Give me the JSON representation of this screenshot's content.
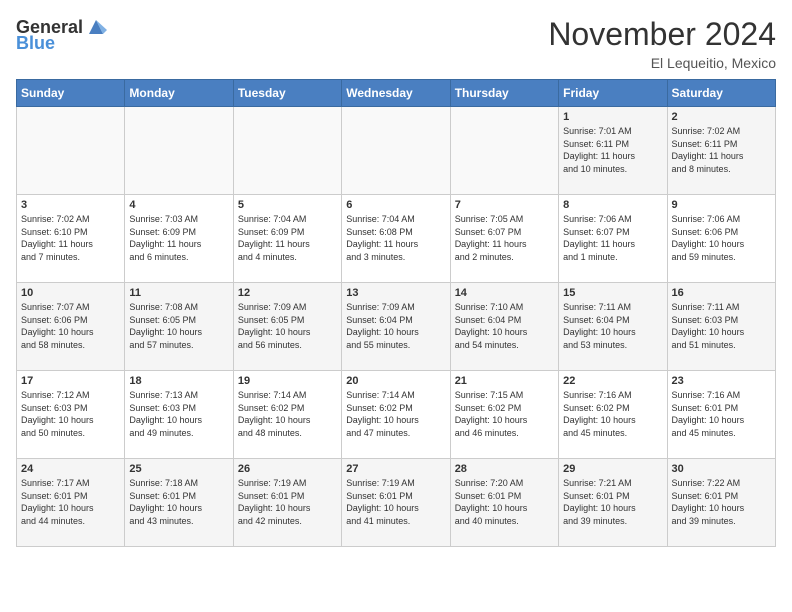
{
  "header": {
    "logo_general": "General",
    "logo_blue": "Blue",
    "month": "November 2024",
    "location": "El Lequeitio, Mexico"
  },
  "weekdays": [
    "Sunday",
    "Monday",
    "Tuesday",
    "Wednesday",
    "Thursday",
    "Friday",
    "Saturday"
  ],
  "rows": [
    [
      {
        "day": "",
        "info": ""
      },
      {
        "day": "",
        "info": ""
      },
      {
        "day": "",
        "info": ""
      },
      {
        "day": "",
        "info": ""
      },
      {
        "day": "",
        "info": ""
      },
      {
        "day": "1",
        "info": "Sunrise: 7:01 AM\nSunset: 6:11 PM\nDaylight: 11 hours\nand 10 minutes."
      },
      {
        "day": "2",
        "info": "Sunrise: 7:02 AM\nSunset: 6:11 PM\nDaylight: 11 hours\nand 8 minutes."
      }
    ],
    [
      {
        "day": "3",
        "info": "Sunrise: 7:02 AM\nSunset: 6:10 PM\nDaylight: 11 hours\nand 7 minutes."
      },
      {
        "day": "4",
        "info": "Sunrise: 7:03 AM\nSunset: 6:09 PM\nDaylight: 11 hours\nand 6 minutes."
      },
      {
        "day": "5",
        "info": "Sunrise: 7:04 AM\nSunset: 6:09 PM\nDaylight: 11 hours\nand 4 minutes."
      },
      {
        "day": "6",
        "info": "Sunrise: 7:04 AM\nSunset: 6:08 PM\nDaylight: 11 hours\nand 3 minutes."
      },
      {
        "day": "7",
        "info": "Sunrise: 7:05 AM\nSunset: 6:07 PM\nDaylight: 11 hours\nand 2 minutes."
      },
      {
        "day": "8",
        "info": "Sunrise: 7:06 AM\nSunset: 6:07 PM\nDaylight: 11 hours\nand 1 minute."
      },
      {
        "day": "9",
        "info": "Sunrise: 7:06 AM\nSunset: 6:06 PM\nDaylight: 10 hours\nand 59 minutes."
      }
    ],
    [
      {
        "day": "10",
        "info": "Sunrise: 7:07 AM\nSunset: 6:06 PM\nDaylight: 10 hours\nand 58 minutes."
      },
      {
        "day": "11",
        "info": "Sunrise: 7:08 AM\nSunset: 6:05 PM\nDaylight: 10 hours\nand 57 minutes."
      },
      {
        "day": "12",
        "info": "Sunrise: 7:09 AM\nSunset: 6:05 PM\nDaylight: 10 hours\nand 56 minutes."
      },
      {
        "day": "13",
        "info": "Sunrise: 7:09 AM\nSunset: 6:04 PM\nDaylight: 10 hours\nand 55 minutes."
      },
      {
        "day": "14",
        "info": "Sunrise: 7:10 AM\nSunset: 6:04 PM\nDaylight: 10 hours\nand 54 minutes."
      },
      {
        "day": "15",
        "info": "Sunrise: 7:11 AM\nSunset: 6:04 PM\nDaylight: 10 hours\nand 53 minutes."
      },
      {
        "day": "16",
        "info": "Sunrise: 7:11 AM\nSunset: 6:03 PM\nDaylight: 10 hours\nand 51 minutes."
      }
    ],
    [
      {
        "day": "17",
        "info": "Sunrise: 7:12 AM\nSunset: 6:03 PM\nDaylight: 10 hours\nand 50 minutes."
      },
      {
        "day": "18",
        "info": "Sunrise: 7:13 AM\nSunset: 6:03 PM\nDaylight: 10 hours\nand 49 minutes."
      },
      {
        "day": "19",
        "info": "Sunrise: 7:14 AM\nSunset: 6:02 PM\nDaylight: 10 hours\nand 48 minutes."
      },
      {
        "day": "20",
        "info": "Sunrise: 7:14 AM\nSunset: 6:02 PM\nDaylight: 10 hours\nand 47 minutes."
      },
      {
        "day": "21",
        "info": "Sunrise: 7:15 AM\nSunset: 6:02 PM\nDaylight: 10 hours\nand 46 minutes."
      },
      {
        "day": "22",
        "info": "Sunrise: 7:16 AM\nSunset: 6:02 PM\nDaylight: 10 hours\nand 45 minutes."
      },
      {
        "day": "23",
        "info": "Sunrise: 7:16 AM\nSunset: 6:01 PM\nDaylight: 10 hours\nand 45 minutes."
      }
    ],
    [
      {
        "day": "24",
        "info": "Sunrise: 7:17 AM\nSunset: 6:01 PM\nDaylight: 10 hours\nand 44 minutes."
      },
      {
        "day": "25",
        "info": "Sunrise: 7:18 AM\nSunset: 6:01 PM\nDaylight: 10 hours\nand 43 minutes."
      },
      {
        "day": "26",
        "info": "Sunrise: 7:19 AM\nSunset: 6:01 PM\nDaylight: 10 hours\nand 42 minutes."
      },
      {
        "day": "27",
        "info": "Sunrise: 7:19 AM\nSunset: 6:01 PM\nDaylight: 10 hours\nand 41 minutes."
      },
      {
        "day": "28",
        "info": "Sunrise: 7:20 AM\nSunset: 6:01 PM\nDaylight: 10 hours\nand 40 minutes."
      },
      {
        "day": "29",
        "info": "Sunrise: 7:21 AM\nSunset: 6:01 PM\nDaylight: 10 hours\nand 39 minutes."
      },
      {
        "day": "30",
        "info": "Sunrise: 7:22 AM\nSunset: 6:01 PM\nDaylight: 10 hours\nand 39 minutes."
      }
    ]
  ]
}
